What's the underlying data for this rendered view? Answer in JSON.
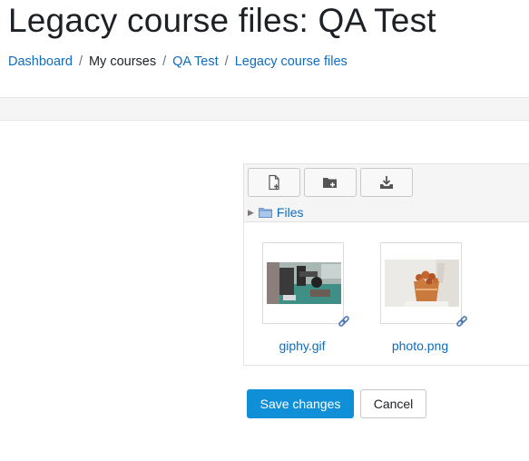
{
  "page": {
    "title": "Legacy course files: QA Test"
  },
  "breadcrumb": {
    "items": [
      {
        "label": "Dashboard"
      },
      {
        "label": "My courses"
      },
      {
        "label": "QA Test"
      },
      {
        "label": "Legacy course files"
      }
    ],
    "separator": "/"
  },
  "filemanager": {
    "toolbar": {
      "add_icon": "add-file-icon",
      "mkdir_icon": "create-folder-icon",
      "download_icon": "download-icon"
    },
    "path": {
      "label": "Files",
      "folder_icon": "folder-icon"
    },
    "files": [
      {
        "name": "giphy.gif",
        "icon": "link-icon"
      },
      {
        "name": "photo.png",
        "icon": "link-icon"
      }
    ]
  },
  "actions": {
    "save_label": "Save changes",
    "cancel_label": "Cancel"
  },
  "colors": {
    "link": "#0f6cbf",
    "primary_button": "#0f8fd7",
    "toolbar_bg": "#f5f5f5"
  }
}
